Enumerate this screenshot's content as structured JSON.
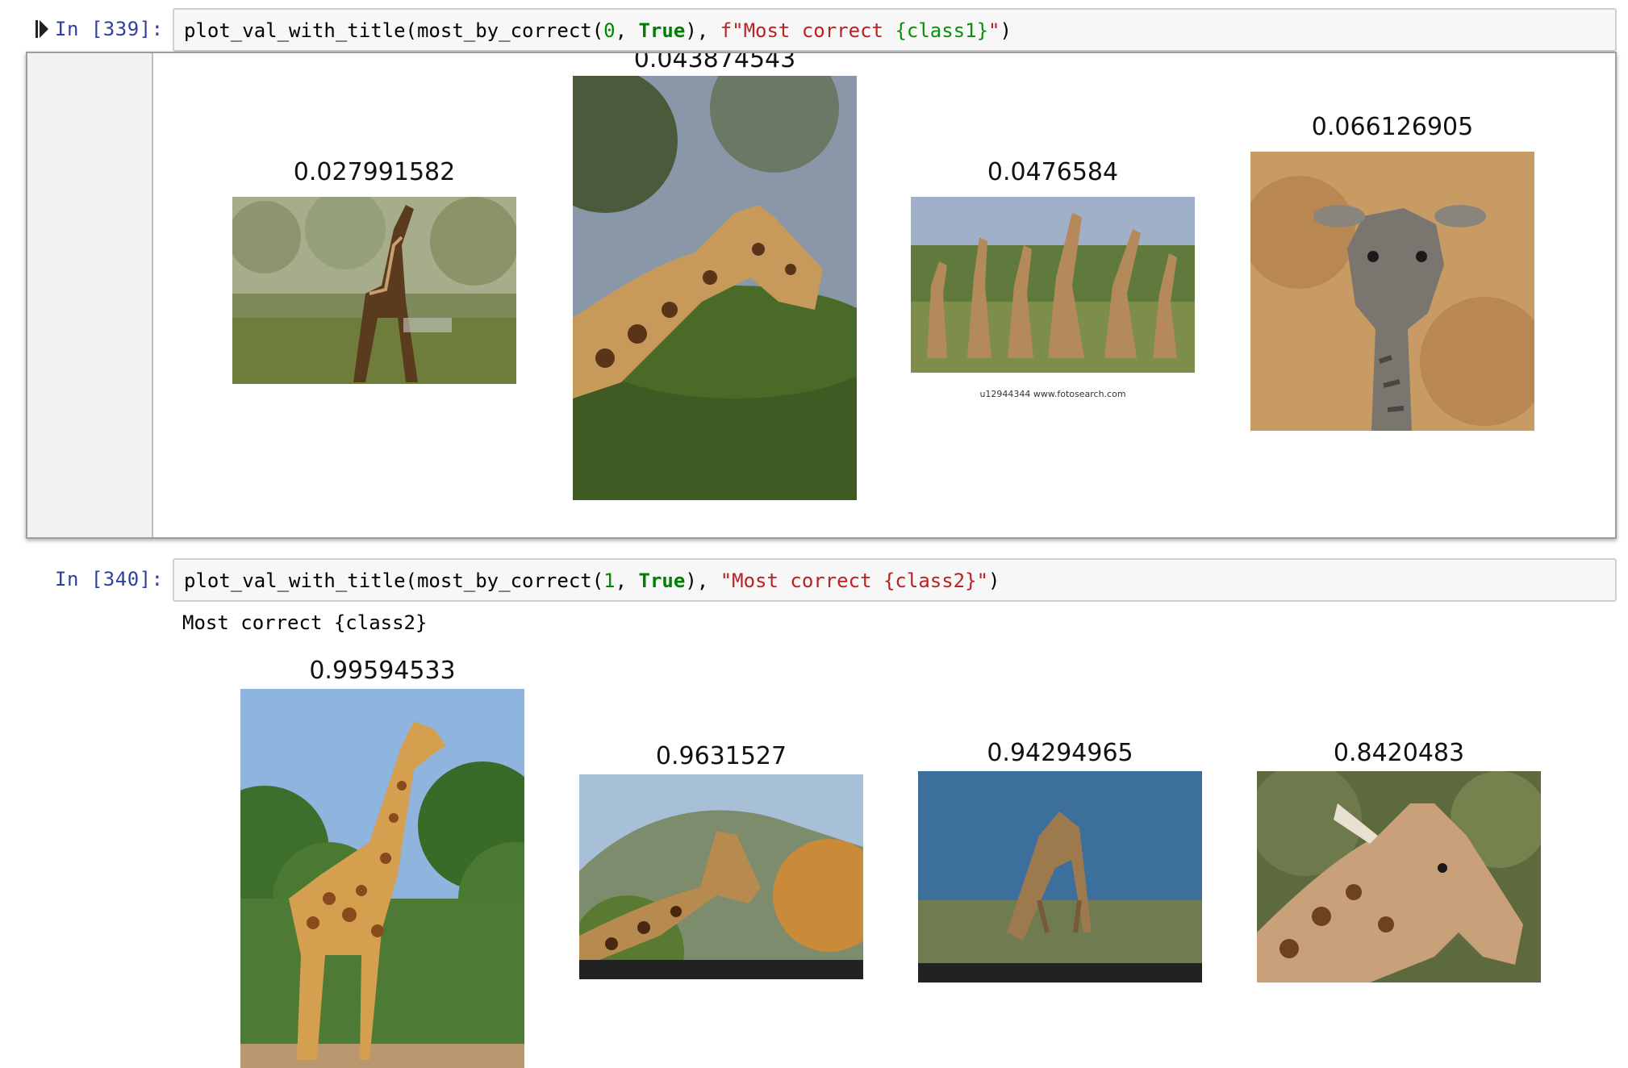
{
  "cell_339": {
    "prompt": "In [339]:",
    "code": {
      "part1": "plot_val_with_title(most_by_correct(",
      "arg_num": "0",
      "sep": ", ",
      "arg_bool": "True",
      "part2": "), ",
      "str_open": "f\"Most correct ",
      "str_brace": "{class1}",
      "str_close": "\"",
      "part3": ")"
    },
    "images": [
      {
        "title": "0.027991582",
        "subject": "giraffe-walking-savanna"
      },
      {
        "title": "0.043874543",
        "subject": "giraffe-head-over-bush"
      },
      {
        "title": "0.0476584",
        "subject": "giraffe-herd",
        "caption": "u12944344 www.fotosearch.com"
      },
      {
        "title": "0.066126905",
        "subject": "baby-giraffe-sand"
      }
    ]
  },
  "cell_340": {
    "prompt": "In [340]:",
    "code": {
      "part1": "plot_val_with_title(most_by_correct(",
      "arg_num": "1",
      "sep": ", ",
      "arg_bool": "True",
      "part2": "), ",
      "str_open": "\"Most correct ",
      "str_brace": "{class2}",
      "str_close": "\"",
      "part3": ")"
    },
    "stdout": "Most correct {class2}",
    "images": [
      {
        "title": "0.99594533",
        "subject": "giraffe-standing-trees"
      },
      {
        "title": "0.9631527",
        "subject": "giraffe-head-hills"
      },
      {
        "title": "0.94294965",
        "subject": "giraffe-drinking-water"
      },
      {
        "title": "0.8420483",
        "subject": "giraffe-head-closeup"
      }
    ]
  },
  "colors": {
    "prompt": "#303f9f",
    "number": "#008800",
    "keyword": "#008000",
    "string": "#ba2121"
  }
}
